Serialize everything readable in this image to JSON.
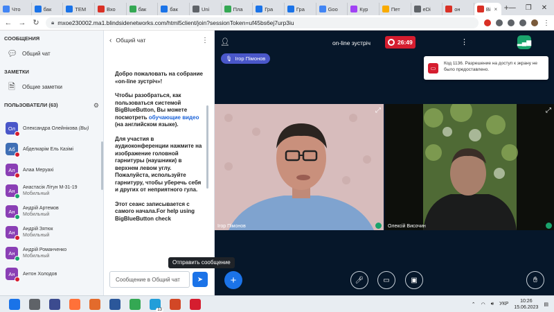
{
  "browser": {
    "tabs": [
      {
        "label": "Что",
        "color": "#4285f4"
      },
      {
        "label": "бак",
        "color": "#1a73e8"
      },
      {
        "label": "TEM",
        "color": "#1a73e8"
      },
      {
        "label": "Вхо",
        "color": "#d93025"
      },
      {
        "label": "бак",
        "color": "#34a853"
      },
      {
        "label": "бак",
        "color": "#1a73e8"
      },
      {
        "label": "Uni",
        "color": "#5f6368"
      },
      {
        "label": "Пла",
        "color": "#34a853"
      },
      {
        "label": "Гра",
        "color": "#1a73e8"
      },
      {
        "label": "Гра",
        "color": "#1a73e8"
      },
      {
        "label": "Goo",
        "color": "#4285f4"
      },
      {
        "label": "Кур",
        "color": "#a142f4"
      },
      {
        "label": "Пет",
        "color": "#f9ab00"
      },
      {
        "label": "eDi",
        "color": "#5f6368"
      },
      {
        "label": "он",
        "color": "#d93025"
      },
      {
        "label": "Bi",
        "color": "#d93025",
        "active": true
      }
    ],
    "url": "mxoe230002.ma1.blindsidenetworks.com/html5client/join?sessionToken=uf45bs6ej7urp3iu"
  },
  "left_panel": {
    "messages_title": "СООБЩЕНИЯ",
    "public_chat": "Общий чат",
    "notes_title": "ЗАМЕТКИ",
    "shared_notes": "Общие заметки",
    "users_title": "ПОЛЬЗОВАТЕЛИ (63)"
  },
  "users": [
    {
      "initials": "Ол",
      "name": "Олександра Олейнікова",
      "suffix": "(Вы)",
      "sub": "",
      "color": "#4a57c9",
      "status": "#d51d2f"
    },
    {
      "initials": "Аб",
      "name": "Абделкарім Ель Казімі",
      "suffix": "",
      "sub": "",
      "color": "#3f6fb5",
      "status": "#d51d2f"
    },
    {
      "initials": "Ал",
      "name": "Алаа Меруахі",
      "suffix": "",
      "sub": "",
      "color": "#8a3fb5",
      "status": "#d51d2f"
    },
    {
      "initials": "Ан",
      "name": "Анастасія Літун М-31-19",
      "suffix": "",
      "sub": "Мобильный",
      "color": "#8a3fb5",
      "status": "#1aa36c"
    },
    {
      "initials": "Ан",
      "name": "Андрій Артемов",
      "suffix": "",
      "sub": "Мобильный",
      "color": "#8a3fb5",
      "status": "#1aa36c"
    },
    {
      "initials": "Ан",
      "name": "Андрій Зятюк",
      "suffix": "",
      "sub": "Мобильный",
      "color": "#8a3fb5",
      "status": "#d51d2f"
    },
    {
      "initials": "Ан",
      "name": "Андрій Романченко",
      "suffix": "",
      "sub": "Мобильный",
      "color": "#8a3fb5",
      "status": "#1aa36c"
    },
    {
      "initials": "Ан",
      "name": "Антон Холодов",
      "suffix": "",
      "sub": "",
      "color": "#8a3fb5",
      "status": "#d51d2f"
    }
  ],
  "chat": {
    "header": "Общий чат",
    "p1_pre": "Добро пожаловать на собрание «",
    "p1_bold": "on-line зустріч",
    "p1_post": "»!",
    "p2_pre": "Чтобы разобраться, как пользоваться системой BigBlueButton, Вы можете посмотреть ",
    "p2_link": "обучающие видео",
    "p2_post": " (на английском языке).",
    "p3_pre": "Для участия в аудиоконференции нажмите на изображение головной гарнитуры (наушники) в верхнем левом углу. ",
    "p3_bold": "Пожалуйста, используйте гарнитуру, чтобы уберечь себя и других от неприятного гула.",
    "p4": "Этот сеанс записывается с самого начала.For help using BigBlueButton check",
    "input_placeholder": "Сообщение в Общий чат",
    "tooltip": "Отправить сообщение"
  },
  "meeting": {
    "name": "on-line зустріч",
    "record_time": "26:49",
    "presenter": "Ігор Пімонов",
    "toast": "Код 1136. Разрешение на доступ к экрану не было предоставлено.",
    "video1_name": "Ігор Пімонов",
    "video2_name": "Олексій Височин"
  },
  "taskbar": {
    "apps": [
      {
        "name": "windows",
        "color": "#1a73e8"
      },
      {
        "name": "search",
        "color": "#5f6368"
      },
      {
        "name": "taskview",
        "color": "#3c4b8f"
      },
      {
        "name": "firefox",
        "color": "#ff7139"
      },
      {
        "name": "matlab",
        "color": "#e36b2c"
      },
      {
        "name": "word",
        "color": "#2b579a"
      },
      {
        "name": "chrome",
        "color": "#34a853"
      },
      {
        "name": "telegram",
        "color": "#229ed9"
      },
      {
        "name": "powerpoint",
        "color": "#d24726"
      },
      {
        "name": "acrobat",
        "color": "#d51d2f"
      }
    ],
    "telegram_badge": "13",
    "lang": "УКР",
    "time": "10:26",
    "date": "15.06.2023"
  }
}
